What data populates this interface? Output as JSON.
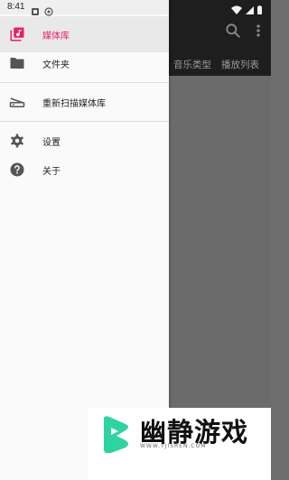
{
  "status_bar": {
    "time": "8:41"
  },
  "background_app": {
    "tabs": [
      {
        "label": "音乐类型"
      },
      {
        "label": "播放列表"
      }
    ]
  },
  "drawer": {
    "items": [
      {
        "label": "媒体库",
        "icon": "library-music-icon",
        "selected": true
      },
      {
        "label": "文件夹",
        "icon": "folder-icon",
        "selected": false
      },
      {
        "label": "重新扫描媒体库",
        "icon": "scanner-icon",
        "selected": false
      },
      {
        "label": "设置",
        "icon": "gear-icon",
        "selected": false
      },
      {
        "label": "关于",
        "icon": "help-icon",
        "selected": false
      }
    ]
  },
  "watermark": {
    "title": "幽静游戏",
    "url": "WWW.YJISREN.COM"
  },
  "colors": {
    "accent": "#e91e63",
    "drawer_bg": "#fafafa",
    "selected_bg": "#e9e9e9",
    "scrim": "#6b6b6b",
    "toolbar": "#1e1e1e",
    "logo_green": "#2dd4a0"
  }
}
